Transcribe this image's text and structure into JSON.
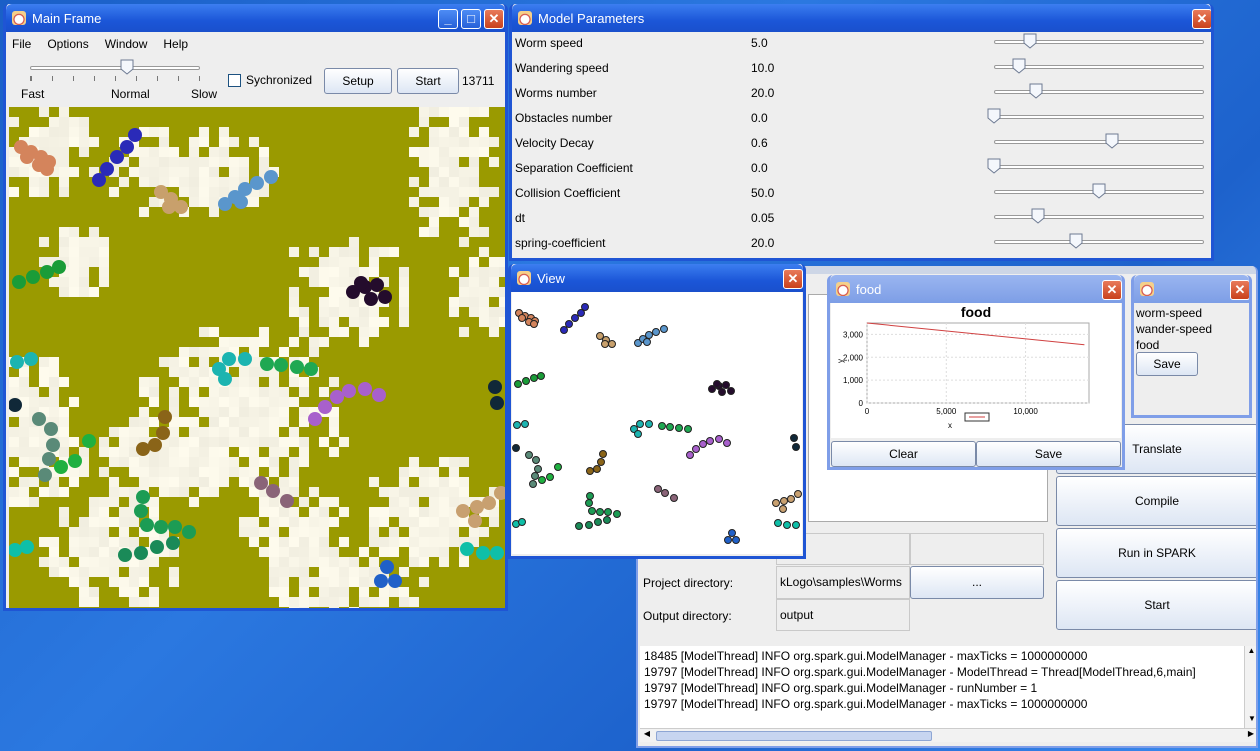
{
  "main_frame": {
    "title": "Main Frame",
    "menu": [
      {
        "label": "File",
        "mnemonic": "F"
      },
      {
        "label": "Options",
        "mnemonic": "O"
      },
      {
        "label": "Window",
        "mnemonic": "W"
      },
      {
        "label": "Help",
        "mnemonic": "H"
      }
    ],
    "speed_labels": {
      "fast": "Fast",
      "normal": "Normal",
      "slow": "Slow"
    },
    "speed_value_fraction": 0.57,
    "synchronized_label": "Sychronized",
    "setup_label": "Setup",
    "start_label": "Start",
    "tick_count": "13711",
    "grid_color": "#9a9a00",
    "food_color": "#f7f4e6"
  },
  "model_parameters": {
    "title": "Model Parameters",
    "params": [
      {
        "name": "Worm speed",
        "value": "5.0",
        "slider": 0.17
      },
      {
        "name": "Wandering speed",
        "value": "10.0",
        "slider": 0.12
      },
      {
        "name": "Worms number",
        "value": "20.0",
        "slider": 0.2
      },
      {
        "name": "Obstacles number",
        "value": "0.0",
        "slider": 0.0
      },
      {
        "name": "Velocity Decay",
        "value": "0.6",
        "slider": 0.56
      },
      {
        "name": "Separation Coefficient",
        "value": "0.0",
        "slider": 0.0
      },
      {
        "name": "Collision Coefficient",
        "value": "50.0",
        "slider": 0.5
      },
      {
        "name": "dt",
        "value": "0.05",
        "slider": 0.21
      },
      {
        "name": "spring-coefficient",
        "value": "20.0",
        "slider": 0.39
      }
    ]
  },
  "view_window": {
    "title": "View"
  },
  "food_window": {
    "title": "food",
    "chart_title": "food",
    "clear_label": "Clear",
    "save_label": "Save",
    "chart_data": {
      "type": "line",
      "title": "food",
      "xlabel": "x",
      "ylabel": "y",
      "x": [
        0,
        13711
      ],
      "series": [
        {
          "values": [
            3500,
            2550
          ],
          "color": "#d04040"
        }
      ],
      "xlim": [
        0,
        14000
      ],
      "ylim": [
        0,
        3500
      ],
      "xticks": [
        "0",
        "5,000",
        "10,000"
      ],
      "yticks": [
        "0",
        "1,000",
        "2,000",
        "3,000"
      ],
      "grid": true
    }
  },
  "vars_window": {
    "items": [
      "worm-speed",
      "wander-speed",
      "food"
    ],
    "save_label": "Save"
  },
  "spark_panel": {
    "buttons": [
      "Translate",
      "Compile",
      "Run in SPARK",
      "Start"
    ],
    "project_name_partial": "ns",
    "project_dir_label": "Project directory:",
    "project_dir_value": "kLogo\\samples\\Worms",
    "browse_label": "...",
    "output_dir_label": "Output directory:",
    "output_dir_value": "output"
  },
  "log": {
    "lines": [
      "18485 [ModelThread] INFO org.spark.gui.ModelManager  - maxTicks = 1000000000",
      "19797 [ModelThread] INFO org.spark.gui.ModelManager  - ModelThread = Thread[ModelThread,6,main]",
      "19797 [ModelThread] INFO org.spark.gui.ModelManager  - runNumber = 1",
      "19797 [ModelThread] INFO org.spark.gui.ModelManager  - maxTicks = 1000000000"
    ]
  }
}
